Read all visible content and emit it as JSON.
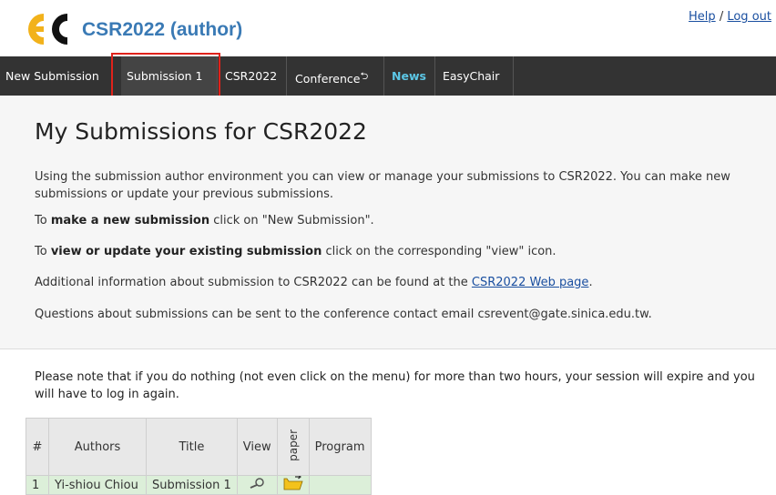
{
  "header": {
    "title": "CSR2022 (author)",
    "help_label": "Help",
    "separator": "/",
    "logout_label": "Log out"
  },
  "menu": {
    "items": [
      {
        "label": "New Submission"
      },
      {
        "label": "Submission 1"
      },
      {
        "label": "CSR2022"
      },
      {
        "label": "Conference"
      },
      {
        "label": "News"
      },
      {
        "label": "EasyChair"
      }
    ]
  },
  "content": {
    "title": "My Submissions for CSR2022",
    "p1": "Using the submission author environment you can view or manage your submissions to CSR2022. You can make new submissions or update your previous submissions.",
    "p2_prefix": "To ",
    "p2_bold": "make a new submission",
    "p2_suffix": " click on \"New Submission\".",
    "p3_prefix": "To ",
    "p3_bold": "view or update your existing submission",
    "p3_suffix": " click on the corresponding \"view\" icon.",
    "p4_prefix": "Additional information about submission to CSR2022 can be found at the ",
    "p4_link": "CSR2022 Web page",
    "p4_suffix": ".",
    "p5": "Questions about submissions can be sent to the conference contact email csrevent@gate.sinica.edu.tw."
  },
  "note": "Please note that if you do nothing (not even click on the menu) for more than two hours, your session will expire and you will have to log in again.",
  "table": {
    "headers": [
      "#",
      "Authors",
      "Title",
      "View",
      "paper",
      "Program"
    ],
    "rows": [
      {
        "num": "1",
        "authors": "Yi-shiou Chiou",
        "title": "Submission 1"
      }
    ]
  },
  "colors": {
    "menubar": "#333333",
    "title_blue": "#3a7ab5",
    "news": "#5cc7e6",
    "highlight": "#e0221b",
    "row_green": "#dcefd9"
  }
}
